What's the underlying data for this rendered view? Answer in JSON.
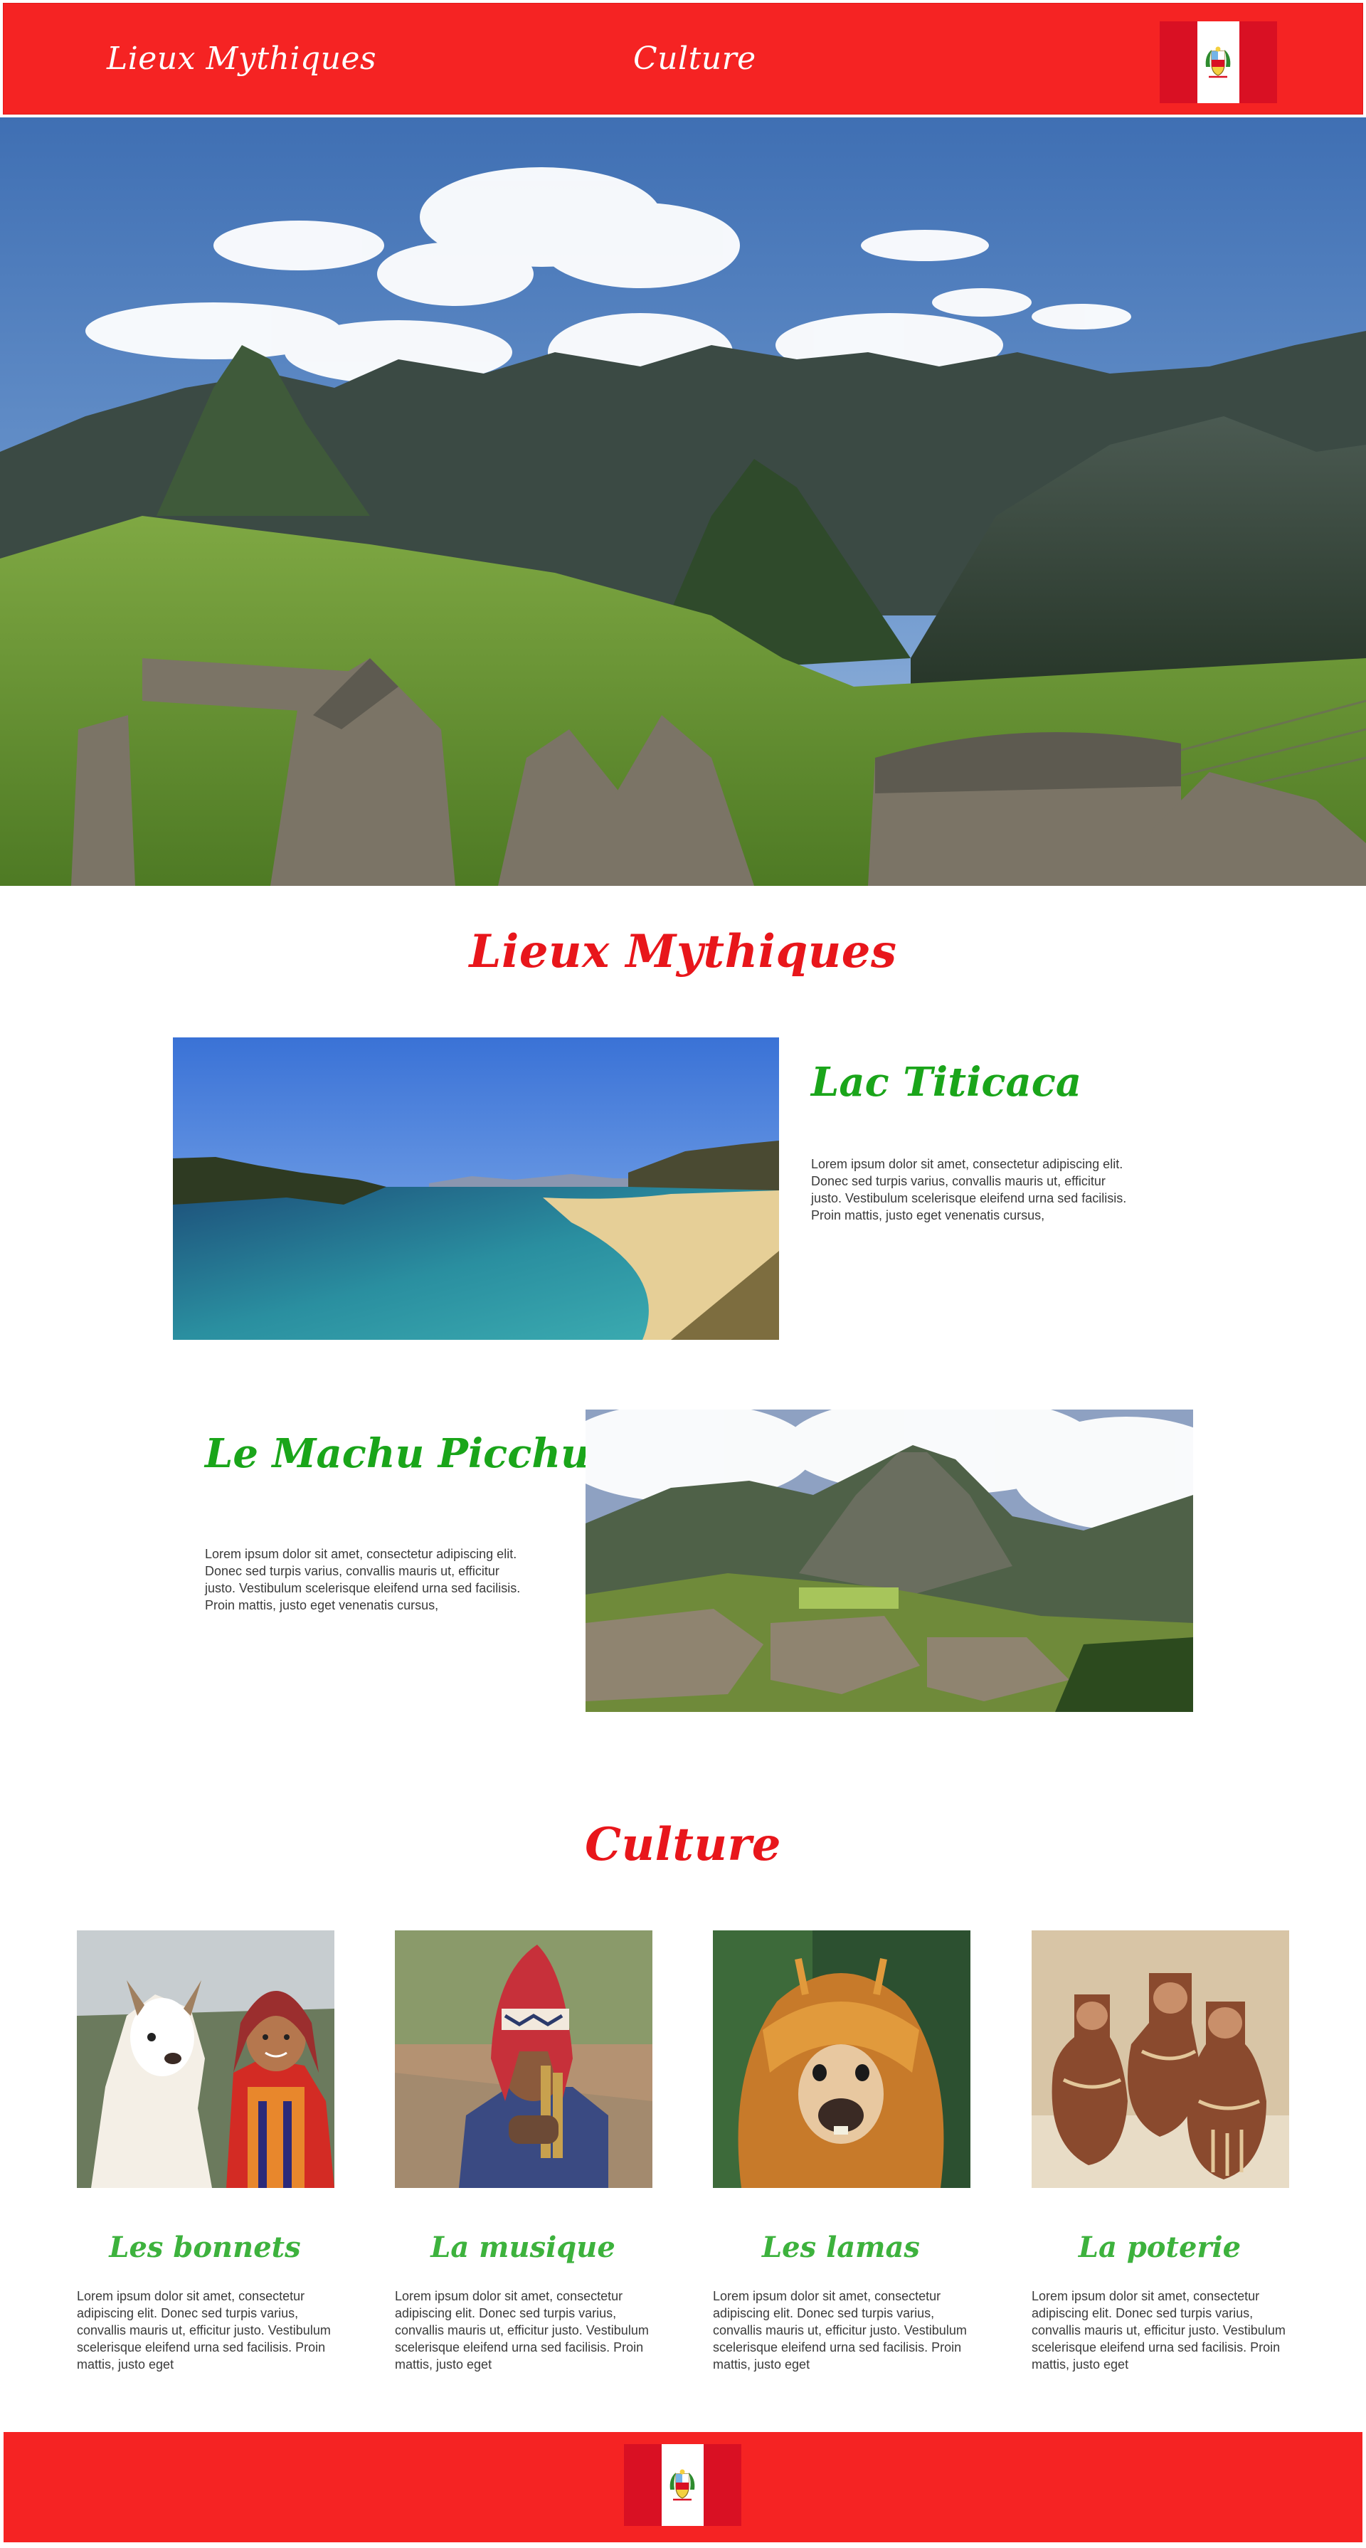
{
  "header": {
    "nav": [
      {
        "label": "Lieux Mythiques"
      },
      {
        "label": "Culture"
      }
    ],
    "flag_icon": "peru-flag-icon"
  },
  "colors": {
    "brand_red": "#f52323",
    "title_red": "#e8161b",
    "green": "#1aa51a",
    "card_green": "#3db23d"
  },
  "sections": {
    "lieux": {
      "title": "Lieux Mythiques",
      "items": [
        {
          "title": "Lac Titicaca",
          "text": "Lorem ipsum dolor sit amet, consectetur adipiscing elit. Donec sed turpis varius, convallis mauris ut, efficitur justo. Vestibulum scelerisque eleifend urna sed facilisis. Proin mattis, justo eget venenatis cursus,"
        },
        {
          "title": "Le Machu Picchu",
          "text": "Lorem ipsum dolor sit amet, consectetur adipiscing elit. Donec sed turpis varius, convallis mauris ut, efficitur justo. Vestibulum scelerisque eleifend urna sed facilisis. Proin mattis, justo eget venenatis cursus,"
        }
      ]
    },
    "culture": {
      "title": "Culture",
      "cards": [
        {
          "title": "Les bonnets",
          "text": "Lorem ipsum dolor sit amet, consectetur adipiscing elit. Donec sed turpis varius, convallis mauris ut, efficitur justo. Vestibulum scelerisque eleifend urna sed facilisis. Proin mattis, justo eget"
        },
        {
          "title": "La musique",
          "text": "Lorem ipsum dolor sit amet, consectetur adipiscing elit. Donec sed turpis varius, convallis mauris ut, efficitur justo. Vestibulum scelerisque eleifend urna sed facilisis. Proin mattis, justo eget"
        },
        {
          "title": "Les lamas",
          "text": "Lorem ipsum dolor sit amet, consectetur adipiscing elit. Donec sed turpis varius, convallis mauris ut, efficitur justo. Vestibulum scelerisque eleifend urna sed facilisis. Proin mattis, justo eget"
        },
        {
          "title": "La poterie",
          "text": "Lorem ipsum dolor sit amet, consectetur adipiscing elit. Donec sed turpis varius, convallis mauris ut, efficitur justo. Vestibulum scelerisque eleifend urna sed facilisis. Proin mattis, justo eget"
        }
      ]
    }
  },
  "footer": {
    "flag_icon": "peru-flag-icon"
  }
}
